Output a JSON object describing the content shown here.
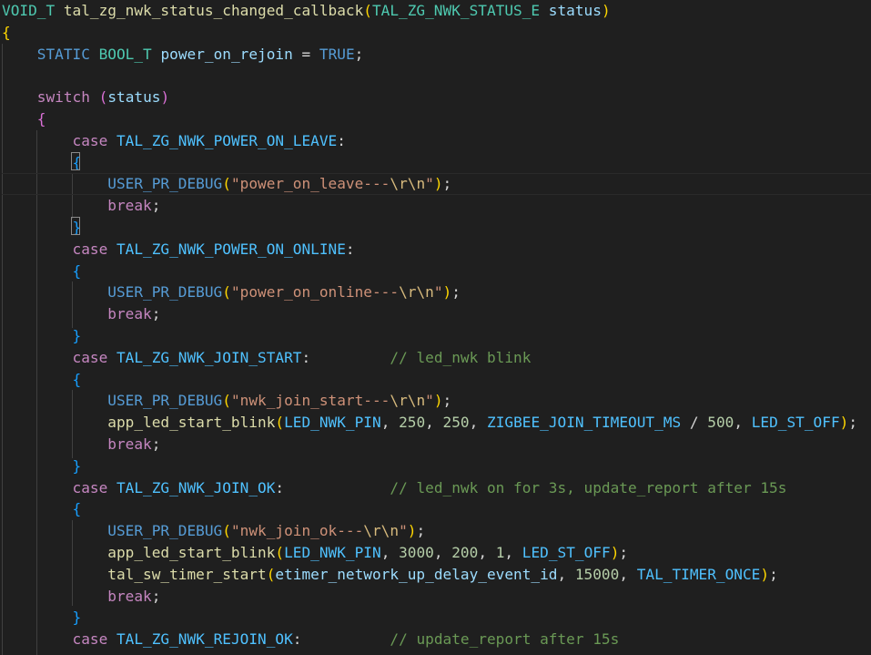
{
  "editor": {
    "lines": [
      [
        {
          "t": "VOID_T",
          "c": "type"
        },
        {
          "t": " ",
          "c": "p"
        },
        {
          "t": "tal_zg_nwk_status_changed_callback",
          "c": "fn"
        },
        {
          "t": "(",
          "c": "b1"
        },
        {
          "t": "TAL_ZG_NWK_STATUS_E",
          "c": "type"
        },
        {
          "t": " ",
          "c": "p"
        },
        {
          "t": "status",
          "c": "var"
        },
        {
          "t": ")",
          "c": "b1"
        }
      ],
      [
        {
          "t": "{",
          "c": "b1"
        }
      ],
      [
        {
          "t": "    ",
          "c": "p"
        },
        {
          "t": "STATIC",
          "c": "kw"
        },
        {
          "t": " ",
          "c": "p"
        },
        {
          "t": "BOOL_T",
          "c": "type"
        },
        {
          "t": " ",
          "c": "p"
        },
        {
          "t": "power_on_rejoin",
          "c": "var"
        },
        {
          "t": " = ",
          "c": "p"
        },
        {
          "t": "TRUE",
          "c": "kw"
        },
        {
          "t": ";",
          "c": "p"
        }
      ],
      [],
      [
        {
          "t": "    ",
          "c": "p"
        },
        {
          "t": "switch",
          "c": "ctl"
        },
        {
          "t": " ",
          "c": "p"
        },
        {
          "t": "(",
          "c": "b2"
        },
        {
          "t": "status",
          "c": "var"
        },
        {
          "t": ")",
          "c": "b2"
        }
      ],
      [
        {
          "t": "    ",
          "c": "p"
        },
        {
          "t": "{",
          "c": "b2"
        }
      ],
      [
        {
          "t": "        ",
          "c": "p"
        },
        {
          "t": "case",
          "c": "ctl"
        },
        {
          "t": " ",
          "c": "p"
        },
        {
          "t": "TAL_ZG_NWK_POWER_ON_LEAVE",
          "c": "const"
        },
        {
          "t": ":",
          "c": "p"
        }
      ],
      [
        {
          "t": "        ",
          "c": "p"
        },
        {
          "t": "{",
          "c": "b3"
        }
      ],
      [
        {
          "t": "            ",
          "c": "p"
        },
        {
          "t": "USER_PR_DEBUG",
          "c": "mac"
        },
        {
          "t": "(",
          "c": "b1"
        },
        {
          "t": "\"power_on_leave---",
          "c": "str"
        },
        {
          "t": "\\r\\n",
          "c": "esc"
        },
        {
          "t": "\"",
          "c": "str"
        },
        {
          "t": ")",
          "c": "b1"
        },
        {
          "t": ";",
          "c": "p"
        }
      ],
      [
        {
          "t": "            ",
          "c": "p"
        },
        {
          "t": "break",
          "c": "ctl"
        },
        {
          "t": ";",
          "c": "p"
        }
      ],
      [
        {
          "t": "        ",
          "c": "p"
        },
        {
          "t": "}",
          "c": "b3"
        }
      ],
      [
        {
          "t": "        ",
          "c": "p"
        },
        {
          "t": "case",
          "c": "ctl"
        },
        {
          "t": " ",
          "c": "p"
        },
        {
          "t": "TAL_ZG_NWK_POWER_ON_ONLINE",
          "c": "const"
        },
        {
          "t": ":",
          "c": "p"
        }
      ],
      [
        {
          "t": "        ",
          "c": "p"
        },
        {
          "t": "{",
          "c": "b3"
        }
      ],
      [
        {
          "t": "            ",
          "c": "p"
        },
        {
          "t": "USER_PR_DEBUG",
          "c": "mac"
        },
        {
          "t": "(",
          "c": "b1"
        },
        {
          "t": "\"power_on_online---",
          "c": "str"
        },
        {
          "t": "\\r\\n",
          "c": "esc"
        },
        {
          "t": "\"",
          "c": "str"
        },
        {
          "t": ")",
          "c": "b1"
        },
        {
          "t": ";",
          "c": "p"
        }
      ],
      [
        {
          "t": "            ",
          "c": "p"
        },
        {
          "t": "break",
          "c": "ctl"
        },
        {
          "t": ";",
          "c": "p"
        }
      ],
      [
        {
          "t": "        ",
          "c": "p"
        },
        {
          "t": "}",
          "c": "b3"
        }
      ],
      [
        {
          "t": "        ",
          "c": "p"
        },
        {
          "t": "case",
          "c": "ctl"
        },
        {
          "t": " ",
          "c": "p"
        },
        {
          "t": "TAL_ZG_NWK_JOIN_START",
          "c": "const"
        },
        {
          "t": ":         ",
          "c": "p"
        },
        {
          "t": "// led_nwk blink",
          "c": "cmt"
        }
      ],
      [
        {
          "t": "        ",
          "c": "p"
        },
        {
          "t": "{",
          "c": "b3"
        }
      ],
      [
        {
          "t": "            ",
          "c": "p"
        },
        {
          "t": "USER_PR_DEBUG",
          "c": "mac"
        },
        {
          "t": "(",
          "c": "b1"
        },
        {
          "t": "\"nwk_join_start---",
          "c": "str"
        },
        {
          "t": "\\r\\n",
          "c": "esc"
        },
        {
          "t": "\"",
          "c": "str"
        },
        {
          "t": ")",
          "c": "b1"
        },
        {
          "t": ";",
          "c": "p"
        }
      ],
      [
        {
          "t": "            ",
          "c": "p"
        },
        {
          "t": "app_led_start_blink",
          "c": "fn"
        },
        {
          "t": "(",
          "c": "b1"
        },
        {
          "t": "LED_NWK_PIN",
          "c": "const"
        },
        {
          "t": ", ",
          "c": "p"
        },
        {
          "t": "250",
          "c": "num"
        },
        {
          "t": ", ",
          "c": "p"
        },
        {
          "t": "250",
          "c": "num"
        },
        {
          "t": ", ",
          "c": "p"
        },
        {
          "t": "ZIGBEE_JOIN_TIMEOUT_MS",
          "c": "const"
        },
        {
          "t": " / ",
          "c": "p"
        },
        {
          "t": "500",
          "c": "num"
        },
        {
          "t": ", ",
          "c": "p"
        },
        {
          "t": "LED_ST_OFF",
          "c": "const"
        },
        {
          "t": ")",
          "c": "b1"
        },
        {
          "t": ";",
          "c": "p"
        }
      ],
      [
        {
          "t": "            ",
          "c": "p"
        },
        {
          "t": "break",
          "c": "ctl"
        },
        {
          "t": ";",
          "c": "p"
        }
      ],
      [
        {
          "t": "        ",
          "c": "p"
        },
        {
          "t": "}",
          "c": "b3"
        }
      ],
      [
        {
          "t": "        ",
          "c": "p"
        },
        {
          "t": "case",
          "c": "ctl"
        },
        {
          "t": " ",
          "c": "p"
        },
        {
          "t": "TAL_ZG_NWK_JOIN_OK",
          "c": "const"
        },
        {
          "t": ":            ",
          "c": "p"
        },
        {
          "t": "// led_nwk on for 3s, update_report after 15s",
          "c": "cmt"
        }
      ],
      [
        {
          "t": "        ",
          "c": "p"
        },
        {
          "t": "{",
          "c": "b3"
        }
      ],
      [
        {
          "t": "            ",
          "c": "p"
        },
        {
          "t": "USER_PR_DEBUG",
          "c": "mac"
        },
        {
          "t": "(",
          "c": "b1"
        },
        {
          "t": "\"nwk_join_ok---",
          "c": "str"
        },
        {
          "t": "\\r\\n",
          "c": "esc"
        },
        {
          "t": "\"",
          "c": "str"
        },
        {
          "t": ")",
          "c": "b1"
        },
        {
          "t": ";",
          "c": "p"
        }
      ],
      [
        {
          "t": "            ",
          "c": "p"
        },
        {
          "t": "app_led_start_blink",
          "c": "fn"
        },
        {
          "t": "(",
          "c": "b1"
        },
        {
          "t": "LED_NWK_PIN",
          "c": "const"
        },
        {
          "t": ", ",
          "c": "p"
        },
        {
          "t": "3000",
          "c": "num"
        },
        {
          "t": ", ",
          "c": "p"
        },
        {
          "t": "200",
          "c": "num"
        },
        {
          "t": ", ",
          "c": "p"
        },
        {
          "t": "1",
          "c": "num"
        },
        {
          "t": ", ",
          "c": "p"
        },
        {
          "t": "LED_ST_OFF",
          "c": "const"
        },
        {
          "t": ")",
          "c": "b1"
        },
        {
          "t": ";",
          "c": "p"
        }
      ],
      [
        {
          "t": "            ",
          "c": "p"
        },
        {
          "t": "tal_sw_timer_start",
          "c": "fn"
        },
        {
          "t": "(",
          "c": "b1"
        },
        {
          "t": "etimer_network_up_delay_event_id",
          "c": "var"
        },
        {
          "t": ", ",
          "c": "p"
        },
        {
          "t": "15000",
          "c": "num"
        },
        {
          "t": ", ",
          "c": "p"
        },
        {
          "t": "TAL_TIMER_ONCE",
          "c": "const"
        },
        {
          "t": ")",
          "c": "b1"
        },
        {
          "t": ";",
          "c": "p"
        }
      ],
      [
        {
          "t": "            ",
          "c": "p"
        },
        {
          "t": "break",
          "c": "ctl"
        },
        {
          "t": ";",
          "c": "p"
        }
      ],
      [
        {
          "t": "        ",
          "c": "p"
        },
        {
          "t": "}",
          "c": "b3"
        }
      ],
      [
        {
          "t": "        ",
          "c": "p"
        },
        {
          "t": "case",
          "c": "ctl"
        },
        {
          "t": " ",
          "c": "p"
        },
        {
          "t": "TAL_ZG_NWK_REJOIN_OK",
          "c": "const"
        },
        {
          "t": ":          ",
          "c": "p"
        },
        {
          "t": "// update_report after 15s",
          "c": "cmt"
        }
      ]
    ],
    "current_line": 8,
    "colors": {
      "background": "#1f1f1f",
      "keyword": "#569cd6",
      "type": "#4ec9b0",
      "function": "#dcdcaa",
      "variable": "#9cdcfe",
      "constant": "#4fc1ff",
      "string": "#ce9178",
      "escape": "#d7ba7d",
      "number": "#b5cea8",
      "comment": "#6a9955",
      "control": "#c586c0",
      "bracket_level1": "#ffd700",
      "bracket_level2": "#da70d6",
      "bracket_level3": "#179fff"
    }
  }
}
